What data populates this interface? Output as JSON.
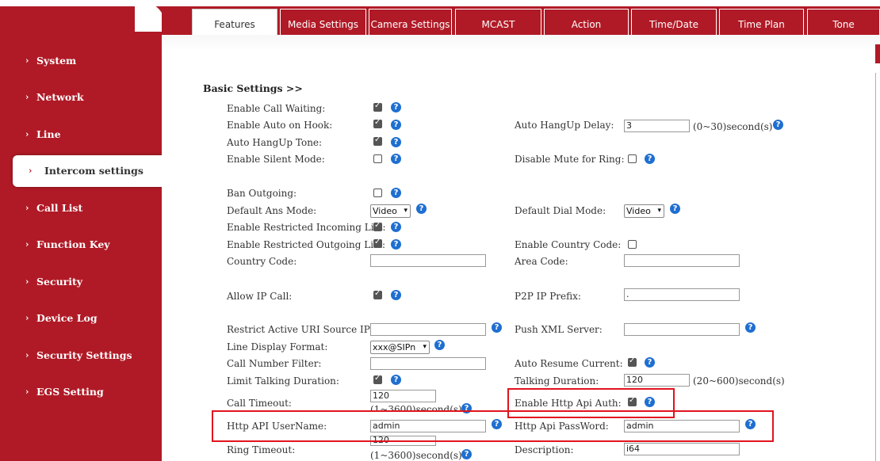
{
  "sidebar": {
    "items": [
      {
        "label": "System"
      },
      {
        "label": "Network"
      },
      {
        "label": "Line"
      },
      {
        "label": "Intercom settings"
      },
      {
        "label": "Call List"
      },
      {
        "label": "Function Key"
      },
      {
        "label": "Security"
      },
      {
        "label": "Device Log"
      },
      {
        "label": "Security Settings"
      },
      {
        "label": "EGS Setting"
      }
    ],
    "active_index": 3
  },
  "tabs": [
    "Features",
    "Media Settings",
    "Camera Settings",
    "MCAST",
    "Action",
    "Time/Date",
    "Time Plan",
    "Tone"
  ],
  "active_tab": "Features",
  "section_title": "Basic Settings >>",
  "fields": {
    "call_waiting": {
      "label": "Enable Call Waiting:",
      "checked": true
    },
    "auto_on_hook": {
      "label": "Enable Auto on Hook:",
      "checked": true
    },
    "auto_hangup_delay": {
      "label": "Auto HangUp Delay:",
      "value": "3",
      "hint": "(0~30)second(s)"
    },
    "auto_hangup_tone": {
      "label": "Auto HangUp Tone:",
      "checked": true
    },
    "silent_mode": {
      "label": "Enable Silent Mode:",
      "checked": false
    },
    "disable_mute_ring": {
      "label": "Disable Mute for Ring:",
      "checked": false
    },
    "ban_outgoing": {
      "label": "Ban Outgoing:",
      "checked": false
    },
    "default_ans_mode": {
      "label": "Default Ans Mode:",
      "value": "Video"
    },
    "default_dial_mode": {
      "label": "Default Dial Mode:",
      "value": "Video"
    },
    "restricted_incoming": {
      "label": "Enable Restricted Incoming List:",
      "checked": true
    },
    "restricted_outgoing": {
      "label": "Enable Restricted Outgoing List:",
      "checked": true
    },
    "country_code_enable": {
      "label": "Enable Country Code:",
      "checked": false
    },
    "country_code": {
      "label": "Country Code:",
      "value": ""
    },
    "area_code": {
      "label": "Area Code:",
      "value": ""
    },
    "allow_ip_call": {
      "label": "Allow IP Call:",
      "checked": true
    },
    "p2p_ip_prefix": {
      "label": "P2P IP Prefix:",
      "value": "."
    },
    "restrict_uri_ip": {
      "label": "Restrict Active URI Source IP:",
      "value": ""
    },
    "push_xml_server": {
      "label": "Push XML Server:",
      "value": ""
    },
    "line_display_format": {
      "label": "Line Display Format:",
      "value": "xxx@SIPn"
    },
    "call_number_filter": {
      "label": "Call Number Filter:",
      "value": ""
    },
    "auto_resume_current": {
      "label": "Auto Resume Current:",
      "checked": true
    },
    "limit_talking_duration": {
      "label": "Limit Talking Duration:",
      "checked": true
    },
    "talking_duration": {
      "label": "Talking Duration:",
      "value": "120",
      "hint": "(20~600)second(s)"
    },
    "call_timeout": {
      "label": "Call Timeout:",
      "value": "120",
      "hint": "(1~3600)second(s)"
    },
    "http_api_auth": {
      "label": "Enable Http Api Auth:",
      "checked": true
    },
    "http_api_username": {
      "label": "Http API UserName:",
      "value": "admin"
    },
    "http_api_password": {
      "label": "Http Api PassWord:",
      "value": "admin"
    },
    "ring_timeout": {
      "label": "Ring Timeout:",
      "value": "120",
      "hint": "(1~3600)second(s)"
    },
    "description": {
      "label": "Description:",
      "value": "i64"
    }
  },
  "icons": {
    "help": "?"
  },
  "colors": {
    "brand_red": "#b01a26",
    "help_blue": "#1e6fd0",
    "highlight_red": "#e0141e"
  }
}
